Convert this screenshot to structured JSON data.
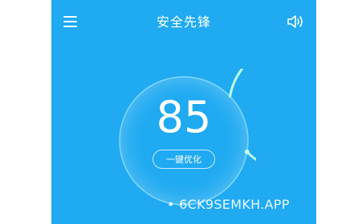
{
  "app": {
    "title": "安全先锋",
    "accent_color": "#1faaf1"
  },
  "header": {
    "menu_icon": "hamburger-menu-icon",
    "sound_icon": "speaker-icon"
  },
  "gauge": {
    "score": "85",
    "progress_fraction": 0.85,
    "track_color": "#7fd6ff",
    "progress_color": "#b9ffdf"
  },
  "actions": {
    "optimize_label": "一键优化"
  },
  "watermark": {
    "text": "• 6CK9SEMKH.APP"
  }
}
